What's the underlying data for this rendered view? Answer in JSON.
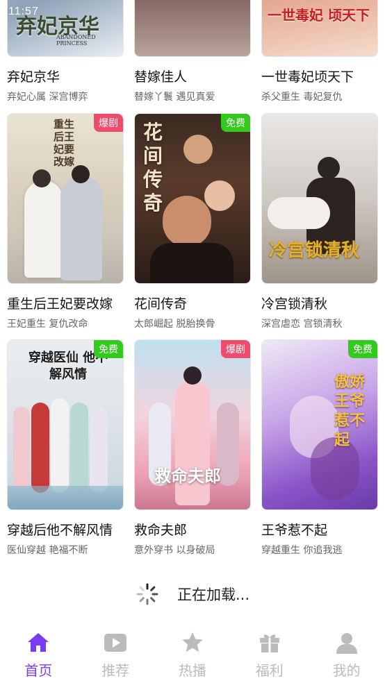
{
  "status_bar": {
    "time": "11:57"
  },
  "colors": {
    "accent": "#7a3cf0",
    "inactive": "#bbbbbb",
    "badge_hot": "#ee4c6c",
    "badge_free": "#33c91d"
  },
  "top_row": [
    {
      "title": "弃妃京华",
      "tags": "弃妃心属 深宫博弈",
      "poster_text": "弃妃京华",
      "poster_sub": "ABANDONED PRINCESS"
    },
    {
      "title": "替嫁佳人",
      "tags": "替嫁丫鬟 遇见真爱"
    },
    {
      "title": "一世毒妃顷天下",
      "tags": "杀父重生 毒妃复仇",
      "poster_text": "一世毒妃 顷天下"
    }
  ],
  "mid_row": [
    {
      "title": "重生后王妃要改嫁",
      "tags": "王妃重生 复仇改命",
      "badge": "爆剧",
      "badge_type": "hot",
      "poster_text": "重生后王妃要改嫁"
    },
    {
      "title": "花间传奇",
      "tags": "太郎崛起 脱胎换骨",
      "badge": "免费",
      "badge_type": "free",
      "poster_text": "花间传奇"
    },
    {
      "title": "冷宫锁清秋",
      "tags": "深宫虐恋 宫锁清秋",
      "poster_text": "冷宫锁清秋"
    }
  ],
  "bottom_row": [
    {
      "title": "穿越后他不解风情",
      "tags": "医仙穿越 艳福不断",
      "badge": "免费",
      "badge_type": "free",
      "poster_text": "穿越医仙 他不解风情"
    },
    {
      "title": "救命夫郎",
      "tags": "意外穿书 以身破局",
      "badge": "爆剧",
      "badge_type": "hot",
      "poster_text": "救命夫郎"
    },
    {
      "title": "王爷惹不起",
      "tags": "穿越重生 你追我逃",
      "badge": "免费",
      "badge_type": "free",
      "poster_text": "傲娇王爷 惹不起"
    }
  ],
  "loading": {
    "text": "正在加载..."
  },
  "tabbar": [
    {
      "label": "首页",
      "icon": "home-icon",
      "active": true
    },
    {
      "label": "推荐",
      "icon": "play-icon",
      "active": false
    },
    {
      "label": "热播",
      "icon": "star-icon",
      "active": false
    },
    {
      "label": "福利",
      "icon": "gift-icon",
      "active": false
    },
    {
      "label": "我的",
      "icon": "user-icon",
      "active": false
    }
  ]
}
